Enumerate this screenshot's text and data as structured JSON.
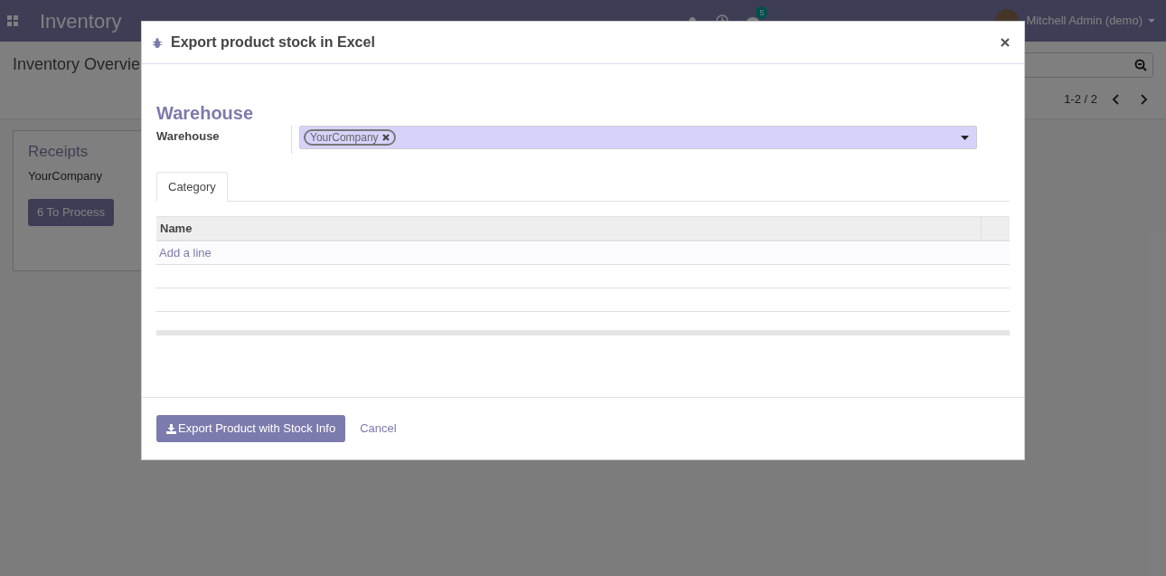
{
  "navbar": {
    "app_name": "Inventory",
    "messages_badge": "5",
    "user": "Mitchell Admin (demo)"
  },
  "control_panel": {
    "breadcrumb": "Inventory Overvie",
    "pager": "1-2 / 2"
  },
  "card": {
    "title": "Receipts",
    "company": "YourCompany",
    "button": "6 To Process"
  },
  "dialog": {
    "title": "Export product stock in Excel",
    "section_title": "Warehouse",
    "field_label": "Warehouse",
    "tags": [
      "YourCompany"
    ],
    "tabs": [
      {
        "label": "Category",
        "selected": true
      }
    ],
    "table": {
      "columns": [
        "Name"
      ],
      "add_line": "Add a line"
    },
    "primary_button": "Export Product with Stock Info",
    "cancel_button": "Cancel"
  }
}
